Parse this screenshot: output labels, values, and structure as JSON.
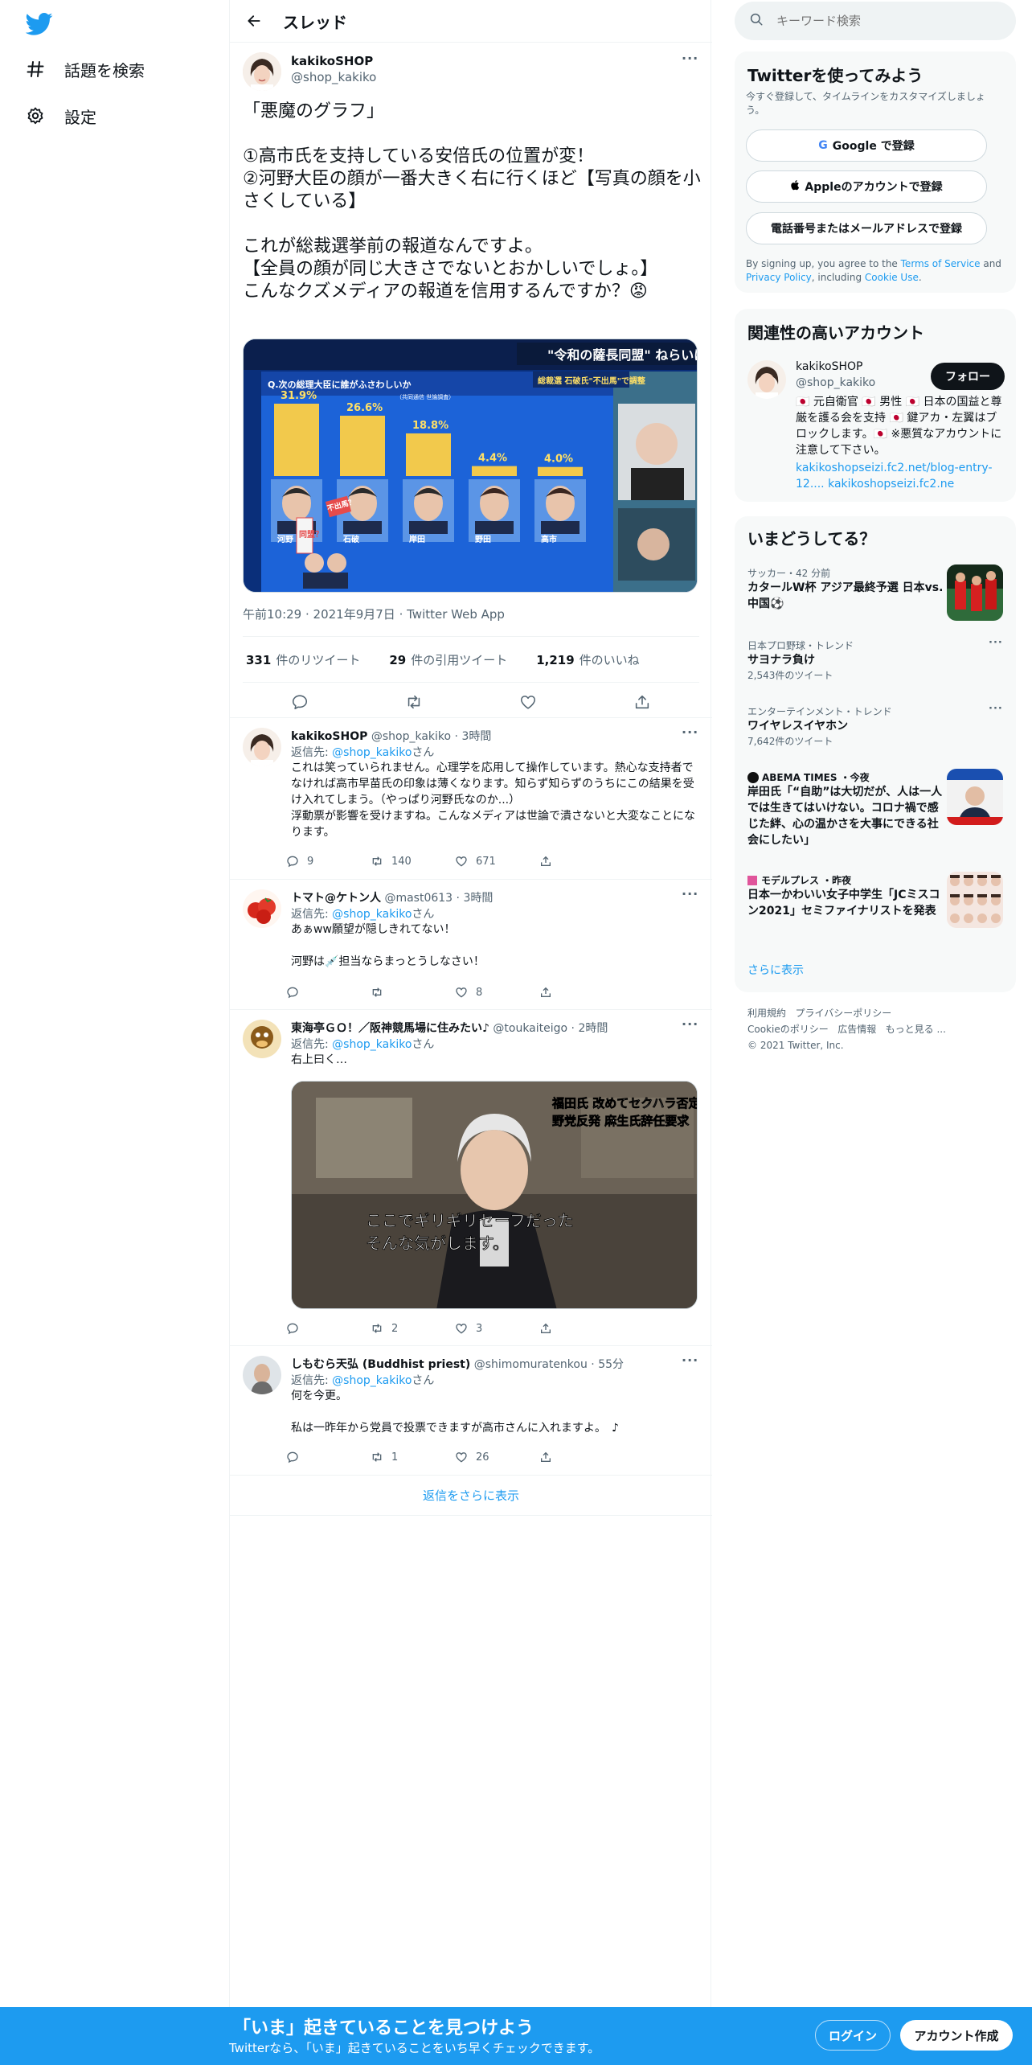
{
  "nav": {
    "explore_label": "話題を検索",
    "settings_label": "設定"
  },
  "thread": {
    "title": "スレッド"
  },
  "main_tweet": {
    "name": "kakikoSHOP",
    "handle": "@shop_kakiko",
    "text": "「悪魔のグラフ」\n\n①高市氏を支持している安倍氏の位置が変！\n②河野大臣の顔が一番大きく右に行くほど【写真の顔を小さくしている】\n\nこれが総裁選挙前の報道なんですよ。\n【全員の顔が同じ大きさでないとおかしいでしょ。】\nこんなクズメディアの報道を信用するんですか？",
    "emoji": "😡",
    "media": {
      "banner": "\"令和の薩長同盟\" ねらいは？",
      "question": "Q.次の総理大臣に誰がふさわしいか",
      "source": "（共同通信 世論調査）",
      "side_tag": "総裁選 石破氏\"不出馬\"で調整",
      "candidates": [
        {
          "name": "河野",
          "pct": "31.9%",
          "value": 31.9
        },
        {
          "name": "石破",
          "pct": "26.6%",
          "value": 26.6
        },
        {
          "name": "岸田",
          "pct": "18.8%",
          "value": 18.8
        },
        {
          "name": "野田",
          "pct": "4.4%",
          "value": 4.4
        },
        {
          "name": "高市",
          "pct": "4.0%",
          "value": 4.0
        }
      ],
      "badge1": "不出馬？",
      "badge2": "同盟？"
    },
    "time": "午前10:29",
    "date": "2021年9月7日",
    "source_app": "Twitter Web App",
    "retweets": "331",
    "retweets_label": "件のリツイート",
    "quotes": "29",
    "quotes_label": "件の引用ツイート",
    "likes": "1,219",
    "likes_label": "件のいいね"
  },
  "replies": [
    {
      "name": "kakikoSHOP",
      "handle": "@shop_kakiko",
      "time": "3時間",
      "replyto_prefix": "返信先: ",
      "replyto": "@shop_kakiko",
      "replyto_suffix": "さん",
      "text": "これは笑っていられません。心理学を応用して操作しています。熱心な支持者でなければ高市早苗氏の印象は薄くなります。知らず知らずのうちにこの結果を受け入れてしまう。（やっぱり河野氏なのか...）\n浮動票が影響を受けますね。こんなメディアは世論で潰さないと大変なことになります。",
      "replies": "9",
      "retweets": "140",
      "likes": "671"
    },
    {
      "name": "トマト@ケトン人",
      "handle": "@mast0613",
      "time": "3時間",
      "replyto_prefix": "返信先: ",
      "replyto": "@shop_kakiko",
      "replyto_suffix": "さん",
      "text": "あぁww願望が隠しきれてない！\n\n河野は💉担当ならまっとうしなさい！",
      "replies": "",
      "retweets": "",
      "likes": "8"
    },
    {
      "name": "東海亭ＧＯ！／阪神競馬場に住みたい♪",
      "handle": "@toukaiteigo",
      "time": "2時間",
      "replyto_prefix": "返信先: ",
      "replyto": "@shop_kakiko",
      "replyto_suffix": "さん",
      "text": "右上曰く…",
      "media": {
        "tag_line1": "福田氏 改めてセクハラ否定",
        "tag_line2": "野党反発 麻生氏辞任要求",
        "caption_line1": "ここでギリギリセーフだった",
        "caption_line2": "そんな気がします。"
      },
      "replies": "",
      "retweets": "2",
      "likes": "3"
    },
    {
      "name": "しもむら天弘 (Buddhist priest)",
      "handle": "@shimomuratenkou",
      "time": "55分",
      "replyto_prefix": "返信先: ",
      "replyto": "@shop_kakiko",
      "replyto_suffix": "さん",
      "text": "何を今更。\n\n私は一昨年から党員で投票できますが高市さんに入れますよ。　♪",
      "replies": "",
      "retweets": "1",
      "likes": "26"
    }
  ],
  "show_more_replies": "返信をさらに表示",
  "sidebar": {
    "search_placeholder": "キーワード検索",
    "signup_panel": {
      "title": "Twitterを使ってみよう",
      "subtitle": "今すぐ登録して、タイムラインをカスタマイズしましょう。",
      "google": "Google で登録",
      "apple": "Appleのアカウントで登録",
      "phone": "電話番号またはメールアドレスで登録",
      "terms_prefix": "By signing up, you agree to the ",
      "terms": "Terms of Service",
      "and": " and ",
      "privacy": "Privacy Policy",
      "including": ", including ",
      "cookie": "Cookie Use",
      "period": "."
    },
    "related": {
      "title": "関連性の高いアカウント",
      "name": "kakikoSHOP",
      "handle": "@shop_kakiko",
      "follow": "フォロー",
      "bio": "🇯🇵 元自衛官 🇯🇵 男性 🇯🇵 日本の国益と尊厳を護る会を支持 🇯🇵 鍵アカ・左翼はブロックします。🇯🇵 ※悪質なアカウントに注意して下さい。",
      "link1": "kakikoshopseizi.fc2.net/blog-entry-12....",
      "link2": "kakikoshopseizi.fc2.ne"
    },
    "trends": {
      "title": "いまどうしてる？",
      "items": [
        {
          "category": "サッカー・42 分前",
          "title": "カタールW杯 アジア最終予選 日本vs.中国⚽",
          "count": ""
        },
        {
          "category": "日本プロ野球・トレンド",
          "title": "サヨナラ負け",
          "count": "2,543件のツイート"
        },
        {
          "category": "エンターテインメント・トレンド",
          "title": "ワイヤレスイヤホン",
          "count": "7,642件のツイート"
        },
        {
          "category": "ABEMA TIMES ・今夜",
          "title": "岸田氏「“自助”は大切だが、人は一人では生きてはいけない。コロナ禍で感じた絆、心の温かさを大事にできる社会にしたい」",
          "count": ""
        },
        {
          "category": "モデルプレス ・昨夜",
          "title": "日本一かわいい女子中学生「JCミスコン2021」セミファイナリストを発表",
          "count": ""
        }
      ],
      "show_more": "さらに表示"
    },
    "footer": {
      "terms": "利用規約",
      "privacy": "プライバシーポリシー",
      "cookie": "Cookieのポリシー",
      "ads": "広告情報",
      "more": "もっと見る ...",
      "copyright": "© 2021 Twitter, Inc."
    }
  },
  "bottom_bar": {
    "title": "「いま」起きていることを見つけよう",
    "subtitle": "Twitterなら、「いま」起きていることをいち早くチェックできます。",
    "login": "ログイン",
    "signup": "アカウント作成"
  }
}
